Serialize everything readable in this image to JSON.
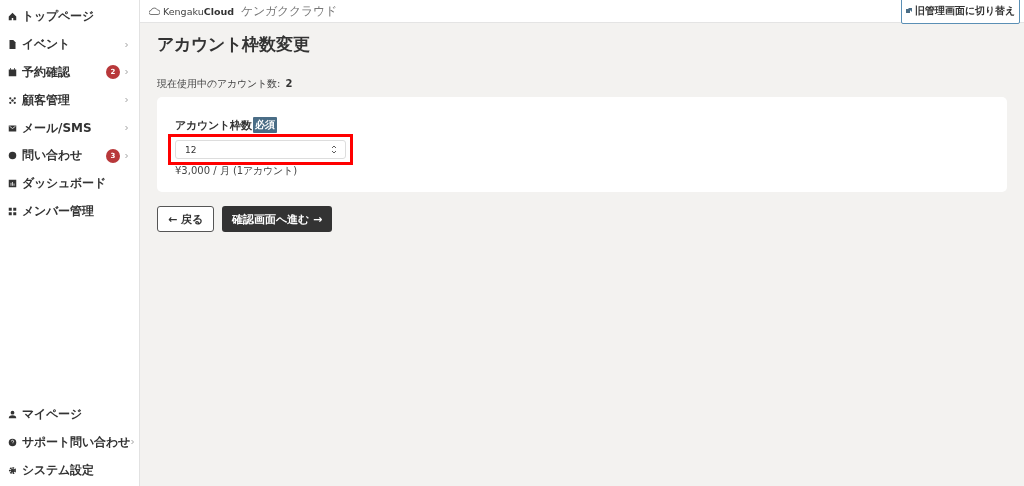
{
  "sidebar": {
    "items": [
      {
        "label": "トップページ",
        "submenu": false
      },
      {
        "label": "イベント",
        "submenu": true
      },
      {
        "label": "予約確認",
        "badge": "2",
        "submenu": true
      },
      {
        "label": "顧客管理",
        "submenu": true
      },
      {
        "label": "メール/SMS",
        "submenu": true
      },
      {
        "label": "問い合わせ",
        "badge": "3",
        "submenu": true
      },
      {
        "label": "ダッシュボード",
        "submenu": false
      },
      {
        "label": "メンバー管理",
        "submenu": false
      }
    ],
    "bottom_items": [
      {
        "label": "マイページ",
        "submenu": false
      },
      {
        "label": "サポート問い合わせ",
        "submenu": true
      },
      {
        "label": "システム設定",
        "submenu": false
      }
    ]
  },
  "header": {
    "logo_light": "Kengaku",
    "logo_bold": "Cloud",
    "logo_sub": "ケンガククラウド",
    "switch_button": "旧管理画面に切り替え"
  },
  "page": {
    "title": "アカウント枠数変更",
    "usage_label": "現在使用中のアカウント数:",
    "usage_value": "2",
    "field": {
      "label": "アカウント枠数",
      "required": "必須",
      "value": "12",
      "highlighted": true,
      "hint": "¥3,000 / 月 (1アカウント)"
    },
    "back_button": "← 戻る",
    "next_button": "確認画面へ進む →"
  }
}
